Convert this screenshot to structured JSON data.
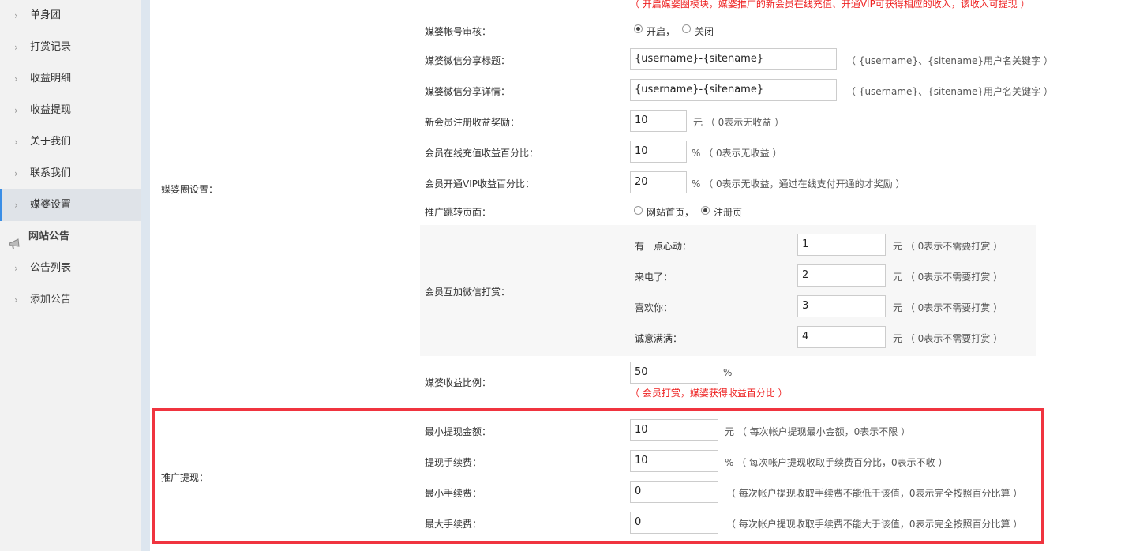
{
  "sidebar": {
    "items": [
      {
        "label": "单身团",
        "chevron": "›"
      },
      {
        "label": "打赏记录",
        "chevron": "›"
      },
      {
        "label": "收益明细",
        "chevron": "›"
      },
      {
        "label": "收益提现",
        "chevron": "›"
      },
      {
        "label": "关于我们",
        "chevron": "›"
      },
      {
        "label": "联系我们",
        "chevron": "›"
      },
      {
        "label": "媒婆设置",
        "chevron": "›"
      }
    ],
    "group": {
      "label": "网站公告",
      "icon": "announcement-icon"
    },
    "group_items": [
      {
        "label": "公告列表",
        "chevron": "›"
      },
      {
        "label": "添加公告",
        "chevron": "›"
      }
    ]
  },
  "matchmaker": {
    "section_label": "媒婆圈设置：",
    "top_note": "（ 开启媒婆圈模块，媒婆推广的新会员在线充值、开通VIP可获得相应的收入，该收入可提现 ）",
    "review": {
      "label": "媒婆帐号审核：",
      "opt_on": "开启，",
      "opt_off": "关闭",
      "selected": "开启"
    },
    "share_title": {
      "label": "媒婆微信分享标题：",
      "value": "{username}-{sitename}",
      "hint": "（ {username}、{sitename}用户名关键字 ）"
    },
    "share_detail": {
      "label": "媒婆微信分享详情：",
      "value": "{username}-{sitename}",
      "hint": "（ {username}、{sitename}用户名关键字 ）"
    },
    "register_reward": {
      "label": "新会员注册收益奖励：",
      "value": "10",
      "hint": "元 （ 0表示无收益 ）"
    },
    "recharge_percent": {
      "label": "会员在线充值收益百分比：",
      "value": "10",
      "hint": "% （ 0表示无收益 ）"
    },
    "vip_percent": {
      "label": "会员开通VIP收益百分比：",
      "value": "20",
      "hint": "% （ 0表示无收益，通过在线支付开通的才奖励 ）"
    },
    "redirect": {
      "label": "推广跳转页面：",
      "opt_home": "网站首页，",
      "opt_register": "注册页",
      "selected": "注册页"
    },
    "tips": {
      "label": "会员互加微信打赏：",
      "items": [
        {
          "label": "有一点心动：",
          "value": "1",
          "hint": "元 （ 0表示不需要打赏 ）"
        },
        {
          "label": "来电了：",
          "value": "2",
          "hint": "元 （ 0表示不需要打赏 ）"
        },
        {
          "label": "喜欢你：",
          "value": "3",
          "hint": "元 （ 0表示不需要打赏 ）"
        },
        {
          "label": "诚意满满：",
          "value": "4",
          "hint": "元 （ 0表示不需要打赏 ）"
        }
      ]
    },
    "income_ratio": {
      "label": "媒婆收益比例：",
      "value": "50",
      "unit": "%",
      "note": "（ 会员打赏，媒婆获得收益百分比 ）"
    }
  },
  "withdraw": {
    "section_label": "推广提现：",
    "min_amount": {
      "label": "最小提现金额：",
      "value": "10",
      "hint": "元 （ 每次帐户提现最小金额，0表示不限 ）"
    },
    "fee": {
      "label": "提现手续费：",
      "value": "10",
      "hint": "% （ 每次帐户提现收取手续费百分比，0表示不收 ）"
    },
    "min_fee": {
      "label": "最小手续费：",
      "value": "0",
      "hint": "（ 每次帐户提现收取手续费不能低于该值，0表示完全按照百分比算 ）"
    },
    "max_fee": {
      "label": "最大手续费：",
      "value": "0",
      "hint": "（ 每次帐户提现收取手续费不能大于该值，0表示完全按照百分比算 ）"
    }
  },
  "colors": {
    "highlight": "#f0343f",
    "note_red": "#e22222",
    "active_bar": "#3a8ee6"
  }
}
